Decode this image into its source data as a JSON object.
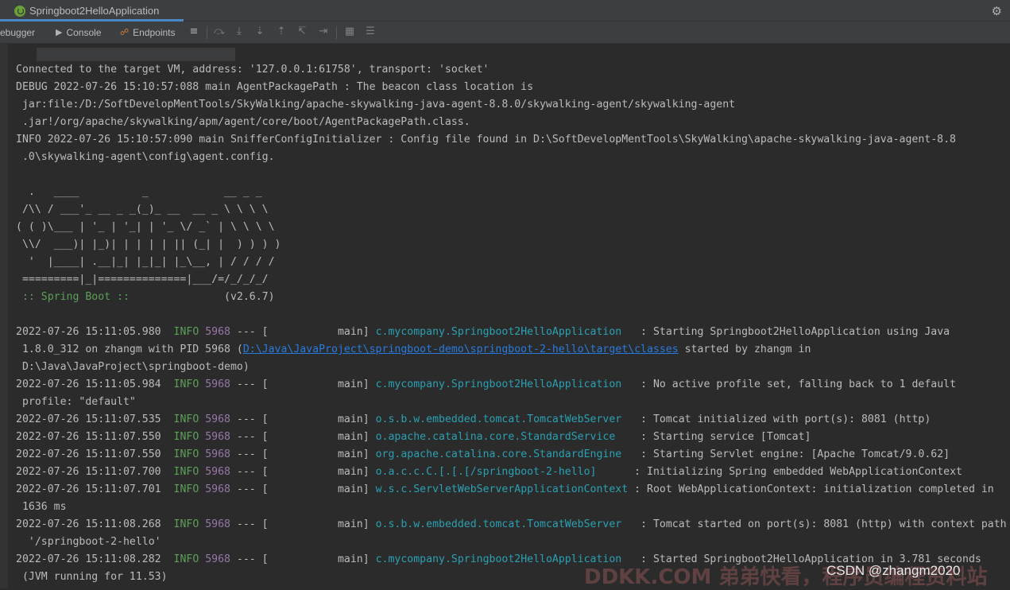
{
  "run_tab": {
    "title": "Springboot2HelloApplication"
  },
  "toolbar": {
    "debugger_label": "ebugger",
    "console_label": "Console",
    "endpoints_label": "Endpoints",
    "icons": [
      "menu-icon",
      "show-execution-point-icon",
      "step-over-icon",
      "step-into-icon",
      "step-out-icon",
      "run-to-cursor-icon",
      "evaluate-icon",
      "frames-icon",
      "settings-icon"
    ]
  },
  "console": {
    "lines": [
      {
        "segments": [
          {
            "t": "Connected to the target VM, address: '127.0.0.1:61758', transport: 'socket'"
          }
        ]
      },
      {
        "segments": [
          {
            "t": "DEBUG 2022-07-26 15:10:57:088 main AgentPackagePath : The beacon class location is"
          }
        ]
      },
      {
        "segments": [
          {
            "t": " jar:file:/D:/SoftDevelopMentTools/SkyWalking/apache-skywalking-java-agent-8.8.0/skywalking-agent/skywalking-agent"
          }
        ]
      },
      {
        "segments": [
          {
            "t": " .jar!/org/apache/skywalking/apm/agent/core/boot/AgentPackagePath.class."
          }
        ]
      },
      {
        "segments": [
          {
            "t": "INFO 2022-07-26 15:10:57:090 main SnifferConfigInitializer : Config file found in D:\\SoftDevelopMentTools\\SkyWalking\\apache-skywalking-java-agent-8.8"
          }
        ]
      },
      {
        "segments": [
          {
            "t": " .0\\skywalking-agent\\config\\agent.config."
          }
        ]
      },
      {
        "segments": [
          {
            "t": ""
          }
        ]
      },
      {
        "segments": [
          {
            "t": "  .   ____          _            __ _ _"
          }
        ]
      },
      {
        "segments": [
          {
            "t": " /\\\\ / ___'_ __ _ _(_)_ __  __ _ \\ \\ \\ \\"
          }
        ]
      },
      {
        "segments": [
          {
            "t": "( ( )\\___ | '_ | '_| | '_ \\/ _` | \\ \\ \\ \\"
          }
        ]
      },
      {
        "segments": [
          {
            "t": " \\\\/  ___)| |_)| | | | | || (_| |  ) ) ) )"
          }
        ]
      },
      {
        "segments": [
          {
            "t": "  '  |____| .__|_| |_|_| |_\\__, | / / / /"
          }
        ]
      },
      {
        "segments": [
          {
            "t": " =========|_|==============|___/=/_/_/_/"
          }
        ]
      },
      {
        "segments": [
          {
            "t": " :: Spring Boot :: ",
            "c": "green"
          },
          {
            "t": "              (v2.6.7)"
          }
        ]
      },
      {
        "segments": [
          {
            "t": ""
          }
        ]
      },
      {
        "segments": [
          {
            "t": "2022-07-26 15:11:05.980  "
          },
          {
            "t": "INFO",
            "c": "green"
          },
          {
            "t": " "
          },
          {
            "t": "5968",
            "c": "purple"
          },
          {
            "t": " --- [           main] "
          },
          {
            "t": "c.mycompany.Springboot2HelloApplication ",
            "c": "teal"
          },
          {
            "t": "  : Starting Springboot2HelloApplication using Java"
          }
        ]
      },
      {
        "segments": [
          {
            "t": " 1.8.0_312 on zhangm with PID 5968 ("
          },
          {
            "t": "D:\\Java\\JavaProject\\springboot-demo\\springboot-2-hello\\target\\classes",
            "c": "link"
          },
          {
            "t": " started by zhangm in"
          }
        ]
      },
      {
        "segments": [
          {
            "t": " D:\\Java\\JavaProject\\springboot-demo)"
          }
        ]
      },
      {
        "segments": [
          {
            "t": "2022-07-26 15:11:05.984  "
          },
          {
            "t": "INFO",
            "c": "green"
          },
          {
            "t": " "
          },
          {
            "t": "5968",
            "c": "purple"
          },
          {
            "t": " --- [           main] "
          },
          {
            "t": "c.mycompany.Springboot2HelloApplication ",
            "c": "teal"
          },
          {
            "t": "  : No active profile set, falling back to 1 default"
          }
        ]
      },
      {
        "segments": [
          {
            "t": " profile: \"default\""
          }
        ]
      },
      {
        "segments": [
          {
            "t": "2022-07-26 15:11:07.535  "
          },
          {
            "t": "INFO",
            "c": "green"
          },
          {
            "t": " "
          },
          {
            "t": "5968",
            "c": "purple"
          },
          {
            "t": " --- [           main] "
          },
          {
            "t": "o.s.b.w.embedded.tomcat.TomcatWebServer ",
            "c": "teal"
          },
          {
            "t": "  : Tomcat initialized with port(s): 8081 (http)"
          }
        ]
      },
      {
        "segments": [
          {
            "t": "2022-07-26 15:11:07.550  "
          },
          {
            "t": "INFO",
            "c": "green"
          },
          {
            "t": " "
          },
          {
            "t": "5968",
            "c": "purple"
          },
          {
            "t": " --- [           main] "
          },
          {
            "t": "o.apache.catalina.core.StandardService  ",
            "c": "teal"
          },
          {
            "t": "  : Starting service [Tomcat]"
          }
        ]
      },
      {
        "segments": [
          {
            "t": "2022-07-26 15:11:07.550  "
          },
          {
            "t": "INFO",
            "c": "green"
          },
          {
            "t": " "
          },
          {
            "t": "5968",
            "c": "purple"
          },
          {
            "t": " --- [           main] "
          },
          {
            "t": "org.apache.catalina.core.StandardEngine ",
            "c": "teal"
          },
          {
            "t": "  : Starting Servlet engine: [Apache Tomcat/9.0.62]"
          }
        ]
      },
      {
        "segments": [
          {
            "t": "2022-07-26 15:11:07.700  "
          },
          {
            "t": "INFO",
            "c": "green"
          },
          {
            "t": " "
          },
          {
            "t": "5968",
            "c": "purple"
          },
          {
            "t": " --- [           main] "
          },
          {
            "t": "o.a.c.c.C.[.[.[/springboot-2-hello]    ",
            "c": "teal"
          },
          {
            "t": "  : Initializing Spring embedded WebApplicationContext"
          }
        ]
      },
      {
        "segments": [
          {
            "t": "2022-07-26 15:11:07.701  "
          },
          {
            "t": "INFO",
            "c": "green"
          },
          {
            "t": " "
          },
          {
            "t": "5968",
            "c": "purple"
          },
          {
            "t": " --- [           main] "
          },
          {
            "t": "w.s.c.ServletWebServerApplicationContext",
            "c": "teal"
          },
          {
            "t": " : Root WebApplicationContext: initialization completed in"
          }
        ]
      },
      {
        "segments": [
          {
            "t": " 1636 ms"
          }
        ]
      },
      {
        "segments": [
          {
            "t": "2022-07-26 15:11:08.268  "
          },
          {
            "t": "INFO",
            "c": "green"
          },
          {
            "t": " "
          },
          {
            "t": "5968",
            "c": "purple"
          },
          {
            "t": " --- [           main] "
          },
          {
            "t": "o.s.b.w.embedded.tomcat.TomcatWebServer ",
            "c": "teal"
          },
          {
            "t": "  : Tomcat started on port(s): 8081 (http) with context path"
          }
        ]
      },
      {
        "segments": [
          {
            "t": "  '/springboot-2-hello'"
          }
        ]
      },
      {
        "segments": [
          {
            "t": "2022-07-26 15:11:08.282  "
          },
          {
            "t": "INFO",
            "c": "green"
          },
          {
            "t": " "
          },
          {
            "t": "5968",
            "c": "purple"
          },
          {
            "t": " --- [           main] "
          },
          {
            "t": "c.mycompany.Springboot2HelloApplication ",
            "c": "teal"
          },
          {
            "t": "  : Started Springboot2HelloApplication in 3.781 seconds"
          }
        ]
      },
      {
        "segments": [
          {
            "t": " (JVM running for 11.53)"
          }
        ]
      }
    ]
  },
  "overlay": {
    "watermark": "DDKK.COM 弟弟快看，程序员编程资料站",
    "csdn": "CSDN @zhangm2020"
  },
  "colors": {
    "green": "#5c9f57",
    "purple": "#9876aa",
    "teal": "#2aa0b3",
    "link": "#287bde",
    "text": "#bbbbbb",
    "bg": "#2b2b2b"
  }
}
